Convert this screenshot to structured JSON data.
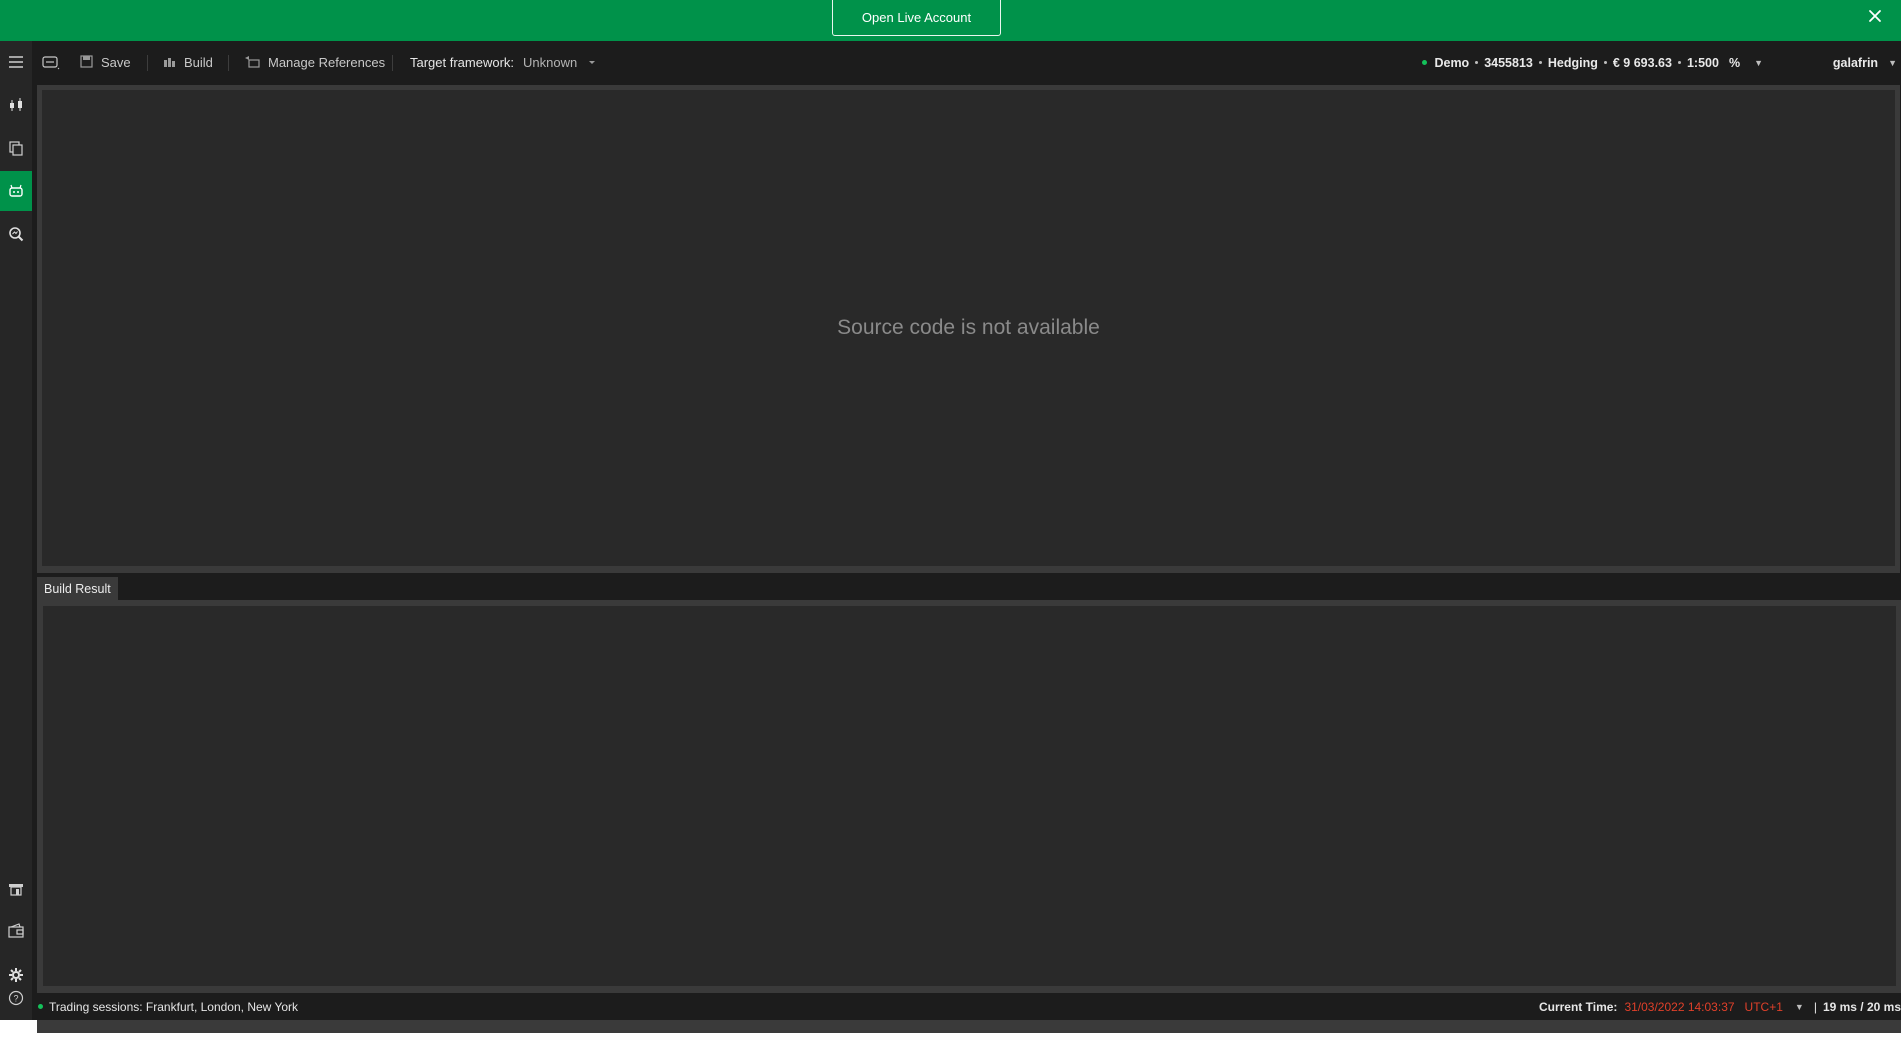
{
  "banner": {
    "open_live_account": "Open Live Account",
    "close_label": "×"
  },
  "rail": {
    "items": [
      {
        "name": "menu"
      },
      {
        "name": "trade"
      },
      {
        "name": "copy"
      },
      {
        "name": "automate",
        "active": true
      },
      {
        "name": "analyze"
      },
      {
        "name": "store"
      },
      {
        "name": "wallet"
      },
      {
        "name": "settings"
      },
      {
        "name": "help"
      }
    ]
  },
  "toolbar": {
    "save_label": "Save",
    "build_label": "Build",
    "manage_refs_label": "Manage References",
    "target_framework_label": "Target framework:",
    "target_framework_value": "Unknown"
  },
  "account": {
    "mode": "Demo",
    "number": "3455813",
    "type": "Hedging",
    "balance": "€ 9 693.63",
    "leverage": "1:500",
    "percent_icon": "%",
    "caret": "▼",
    "username": "galafrin"
  },
  "editor": {
    "message": "Source code is not available"
  },
  "build_result": {
    "tab_label": "Build Result"
  },
  "status": {
    "sessions_text": "Trading sessions: Frankfurt, London, New York",
    "current_time_label": "Current Time:",
    "current_time_value": "31/03/2022 14:03:37",
    "timezone": "UTC+1",
    "caret": "▼",
    "separator": "|",
    "latency": "19 ms / 20 ms"
  },
  "colors": {
    "brand_green": "#00924a",
    "accent_red": "#e0402a",
    "background": "#1c1c1c",
    "panel": "#292929"
  }
}
